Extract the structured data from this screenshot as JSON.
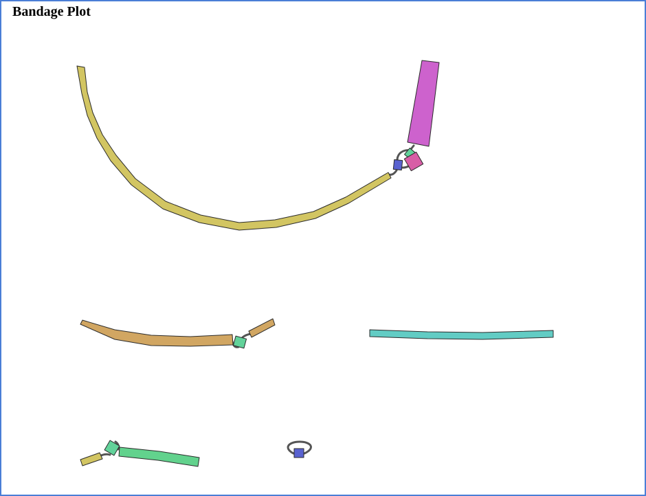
{
  "title": "Bandage Plot",
  "colors": {
    "frame": "#4a7ed6",
    "yellow": "#d2c562",
    "magenta": "#cd62cd",
    "pink": "#d85ea6",
    "mint": "#62d29a",
    "blue": "#5962d0",
    "orange": "#d1a662",
    "cyan": "#62ccc4",
    "edge": "#555555"
  }
}
